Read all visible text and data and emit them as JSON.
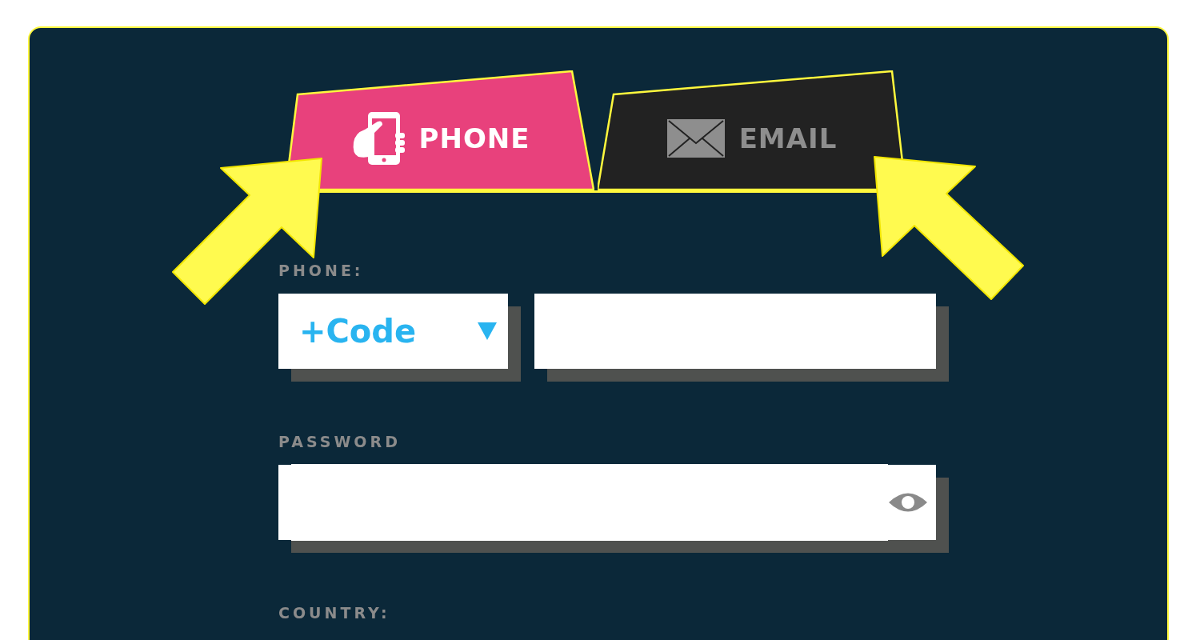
{
  "tabs": [
    {
      "label": "PHONE",
      "kind": "phone",
      "selected": true
    },
    {
      "label": "EMAIL",
      "kind": "email",
      "selected": false
    }
  ],
  "phone": {
    "label": "PHONE:",
    "code": "+Code"
  },
  "password": {
    "label": "PASSWORD"
  },
  "country": {
    "label": "COUNTRY:"
  }
}
